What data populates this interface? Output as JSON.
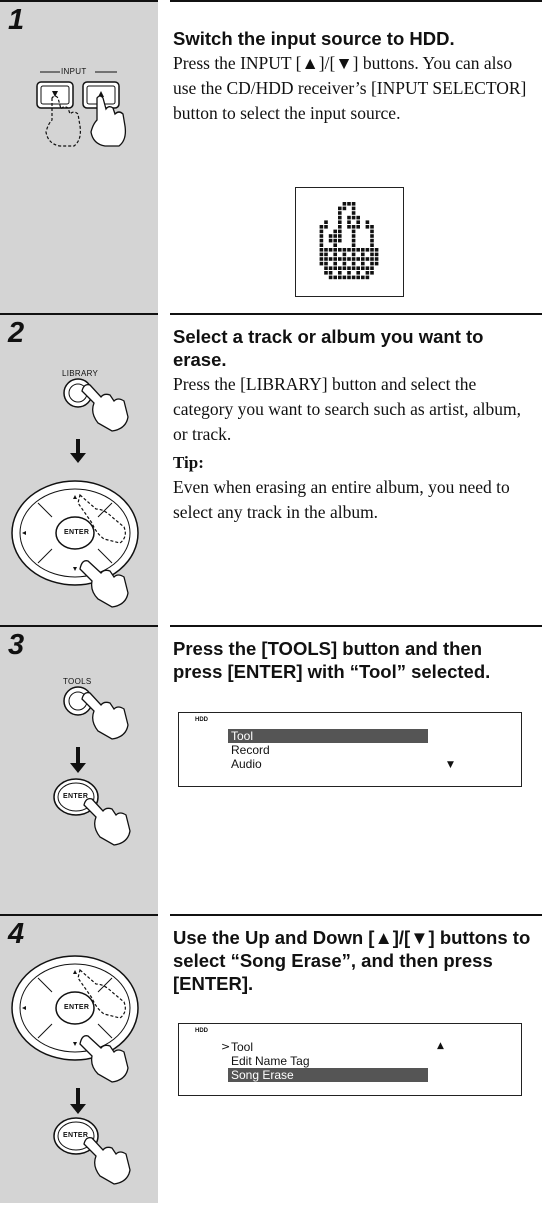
{
  "steps": [
    {
      "number": "1",
      "heading": "Switch the input source to HDD.",
      "body": "Press the INPUT [▲]/[▼] buttons. You can also use the CD/HDD receiver’s [INPUT SELECTOR] button to select the input source.",
      "buttons": {
        "group_label": "INPUT"
      }
    },
    {
      "number": "2",
      "heading": "Select a track or album you want to erase.",
      "body": "Press the [LIBRARY] button and select the category you want to search such as artist, album, or track.",
      "tip_label": "Tip:",
      "tip_text": "Even when erasing an entire album, you need to select any track in the album.",
      "buttons": {
        "library": "LIBRARY",
        "enter": "ENTER"
      }
    },
    {
      "number": "3",
      "heading": "Press the [TOOLS] button and then press [ENTER] with “Tool” selected.",
      "buttons": {
        "tools": "TOOLS",
        "enter": "ENTER"
      },
      "display": {
        "source": "HDD",
        "items": [
          "Tool",
          "Record",
          "Audio"
        ],
        "selected": "Tool"
      }
    },
    {
      "number": "4",
      "heading": "Use the Up and Down [▲]/[▼] buttons to select “Song Erase”, and then press [ENTER].",
      "buttons": {
        "enter_pad": "ENTER",
        "enter": "ENTER"
      },
      "display": {
        "source": "HDD",
        "items": [
          "Tool",
          "Edit Name Tag",
          "Song Erase"
        ],
        "selected": "Song Erase"
      }
    }
  ]
}
